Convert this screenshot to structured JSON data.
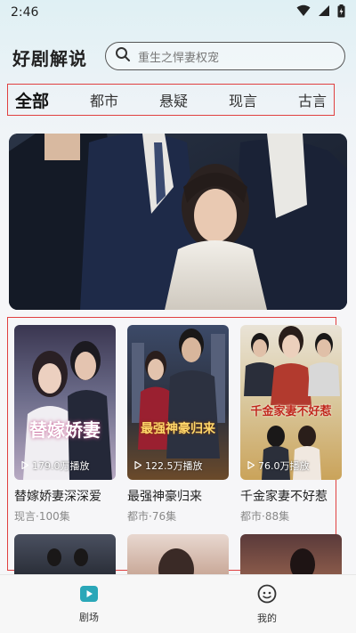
{
  "status_bar": {
    "time": "2:46"
  },
  "header": {
    "title": "好剧解说",
    "search_placeholder": "重生之悍妻权宠"
  },
  "tabs": [
    {
      "label": "全部",
      "active": true
    },
    {
      "label": "都市",
      "active": false
    },
    {
      "label": "悬疑",
      "active": false
    },
    {
      "label": "现言",
      "active": false
    },
    {
      "label": "古言",
      "active": false
    }
  ],
  "dramas": [
    {
      "title": "替嫁娇妻深深爱",
      "meta": "现言·100集",
      "plays": "179.0万播放",
      "poster_text": "替嫁娇妻"
    },
    {
      "title": "最强神豪归来",
      "meta": "都市·76集",
      "plays": "122.5万播放",
      "poster_text": "最强神豪归来"
    },
    {
      "title": "千金家妻不好惹",
      "meta": "都市·88集",
      "plays": "76.0万播放",
      "poster_text": "千金家妻不好惹"
    }
  ],
  "bottom_nav": [
    {
      "label": "剧场",
      "icon": "theater-play-icon",
      "active": true
    },
    {
      "label": "我的",
      "icon": "profile-face-icon",
      "active": false
    }
  ],
  "colors": {
    "accent": "#2aa7b8",
    "highlight_box": "#e04040",
    "search_border": "#555555"
  }
}
